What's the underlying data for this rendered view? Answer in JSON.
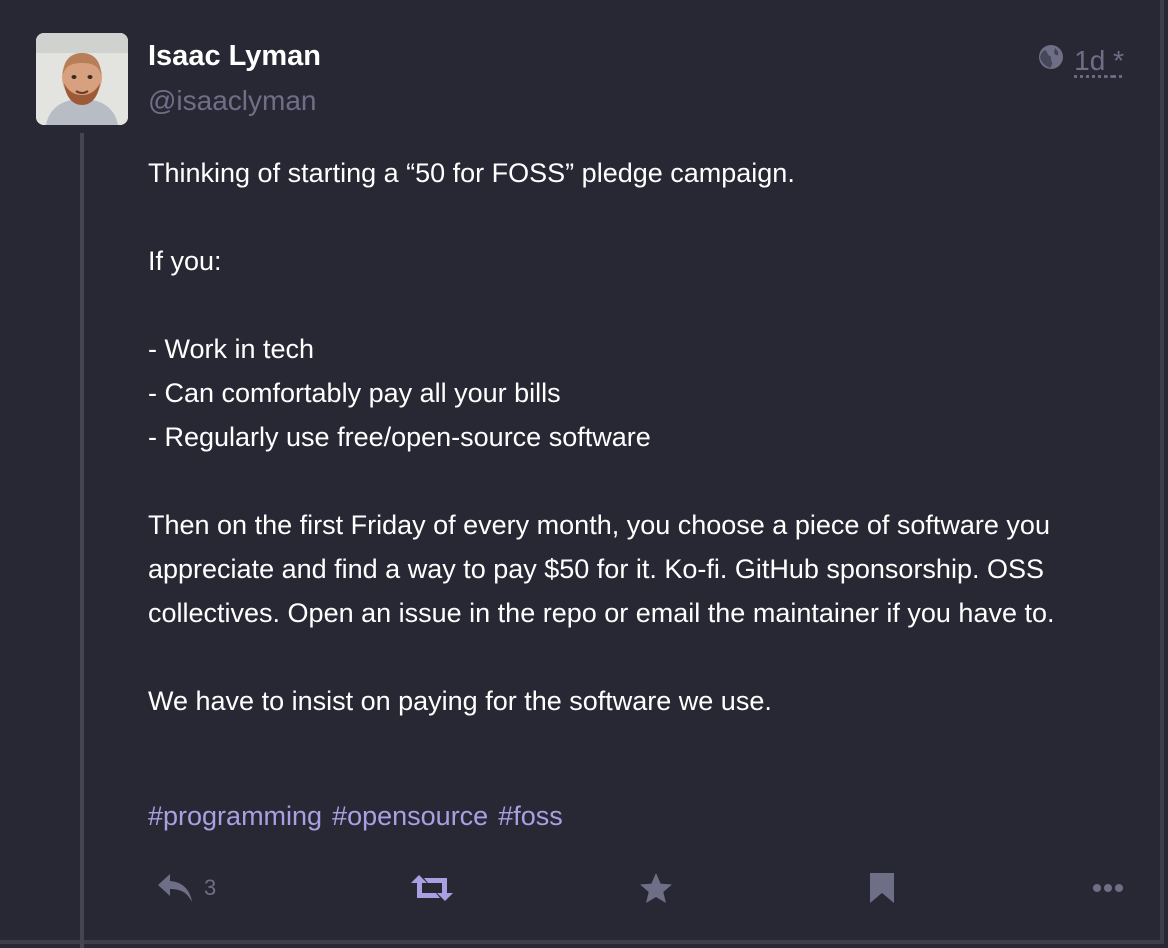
{
  "post": {
    "author": {
      "display_name": "Isaac Lyman",
      "handle": "@isaaclyman",
      "avatar_icon": "avatar-photo"
    },
    "visibility_icon": "globe-icon",
    "time": "1d",
    "edited_marker": "*",
    "content": {
      "p1": "Thinking of starting a “50 for FOSS” pledge campaign.",
      "p2": "If you:",
      "p3_lines": [
        "- Work in tech",
        "- Can comfortably pay all your bills",
        "- Regularly use free/open-source software"
      ],
      "p4": "Then on the first Friday of every month, you choose a piece of software you appreciate and find a way to pay $50 for it. Ko-fi. GitHub sponsorship. OSS collectives. Open an issue in the repo or email the maintainer if you have to.",
      "p5": "We have to insist on paying for the software we use."
    },
    "hashtags": [
      "#programming",
      "#opensource",
      "#foss"
    ],
    "actions": {
      "reply_icon": "reply-icon",
      "reply_count": "3",
      "boost_icon": "boost-icon",
      "favourite_icon": "star-icon",
      "bookmark_icon": "bookmark-icon",
      "more_icon": "ellipsis-icon"
    },
    "colors": {
      "background": "#282834",
      "muted": "#6f6e87",
      "hashtag": "#a9a0e3",
      "boost_active": "#a9a0e3",
      "text": "#ffffff"
    }
  }
}
